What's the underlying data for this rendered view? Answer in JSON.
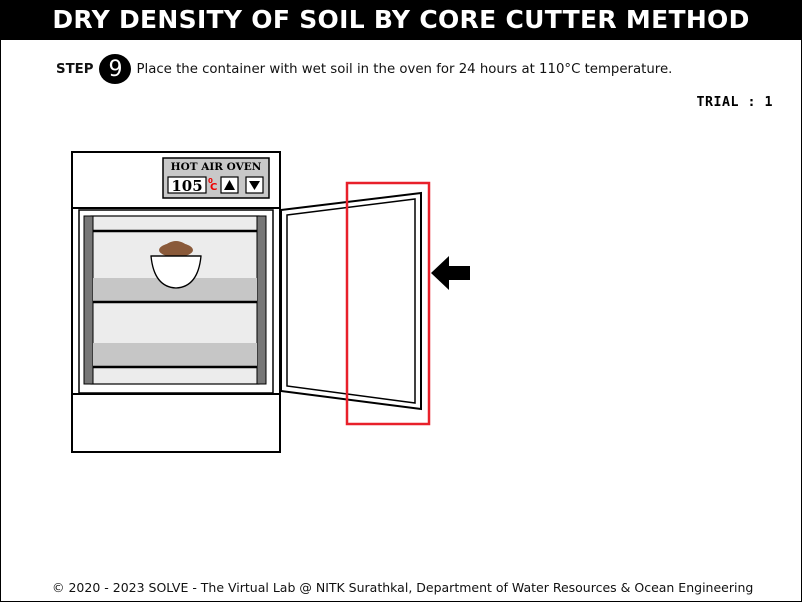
{
  "header": {
    "title": "DRY DENSITY OF SOIL BY CORE CUTTER METHOD"
  },
  "step": {
    "label": "STEP",
    "number": "9",
    "instruction": "Place the container with wet soil in the oven for 24 hours at 110°C temperature."
  },
  "trial": {
    "text": "TRIAL : 1"
  },
  "oven": {
    "label": "HOT AIR OVEN",
    "temperature": "105",
    "degree_mark": "0",
    "unit": "C",
    "up_icon": "triangle-up-icon",
    "down_icon": "triangle-down-icon"
  },
  "highlight": {
    "color": "#e8202a"
  },
  "pointer": {
    "icon": "left-arrow-icon"
  },
  "footer": {
    "text": "© 2020 - 2023 SOLVE - The Virtual Lab @ NITK Surathkal, Department of Water Resources & Ocean Engineering"
  }
}
